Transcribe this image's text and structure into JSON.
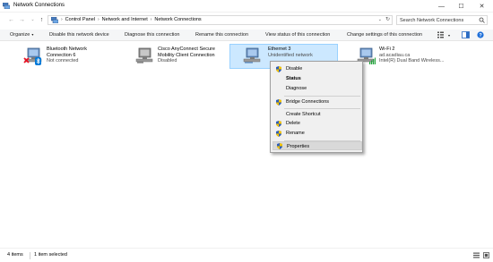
{
  "window": {
    "title": "Network Connections",
    "minimize_glyph": "—",
    "maximize_glyph": "☐",
    "close_glyph": "✕"
  },
  "address": {
    "back_glyph": "←",
    "forward_glyph": "→",
    "recent_glyph": "⌄",
    "up_glyph": "↑",
    "crumbs": [
      "Control Panel",
      "Network and Internet",
      "Network Connections"
    ],
    "separator": "›",
    "dropdown_glyph": "⌄",
    "refresh_glyph": "↻"
  },
  "search": {
    "placeholder": "Search Network Connections"
  },
  "toolbar": {
    "organize": "Organize",
    "caret": "▾",
    "disable_device": "Disable this network device",
    "diagnose": "Diagnose this connection",
    "rename": "Rename this connection",
    "view_status": "View status of this connection",
    "change_settings": "Change settings of this connection"
  },
  "connections": [
    {
      "name": "Bluetooth Network",
      "name2": "Connection 6",
      "status": "Not connected",
      "icon": "bluetooth-network-icon"
    },
    {
      "name": "Cisco AnyConnect Secure",
      "name2": "Mobility Client Connection",
      "status": "Disabled",
      "icon": "vpn-adapter-icon"
    },
    {
      "name": "Ethernet 3",
      "name2": "Unidentified network",
      "status": "",
      "icon": "ethernet-adapter-icon"
    },
    {
      "name": "Wi-Fi 2",
      "name2": "ad.acadiau.ca",
      "status": "Intel(R) Dual Band Wireless...",
      "icon": "wifi-adapter-icon"
    }
  ],
  "context_menu": {
    "disable": "Disable",
    "status": "Status",
    "diagnose": "Diagnose",
    "bridge": "Bridge Connections",
    "shortcut": "Create Shortcut",
    "delete": "Delete",
    "rename": "Rename",
    "properties": "Properties"
  },
  "statusbar": {
    "items": "4 items",
    "selected": "1 item selected"
  },
  "colors": {
    "selection_bg": "#cce8ff",
    "selection_border": "#99d1ff",
    "menu_bg": "#f0f0f0",
    "shield_blue": "#2f5fb8",
    "shield_yellow": "#f5c400",
    "error_red": "#e81123",
    "bluetooth_blue": "#0078d7",
    "wifi_green": "#22a33a"
  }
}
